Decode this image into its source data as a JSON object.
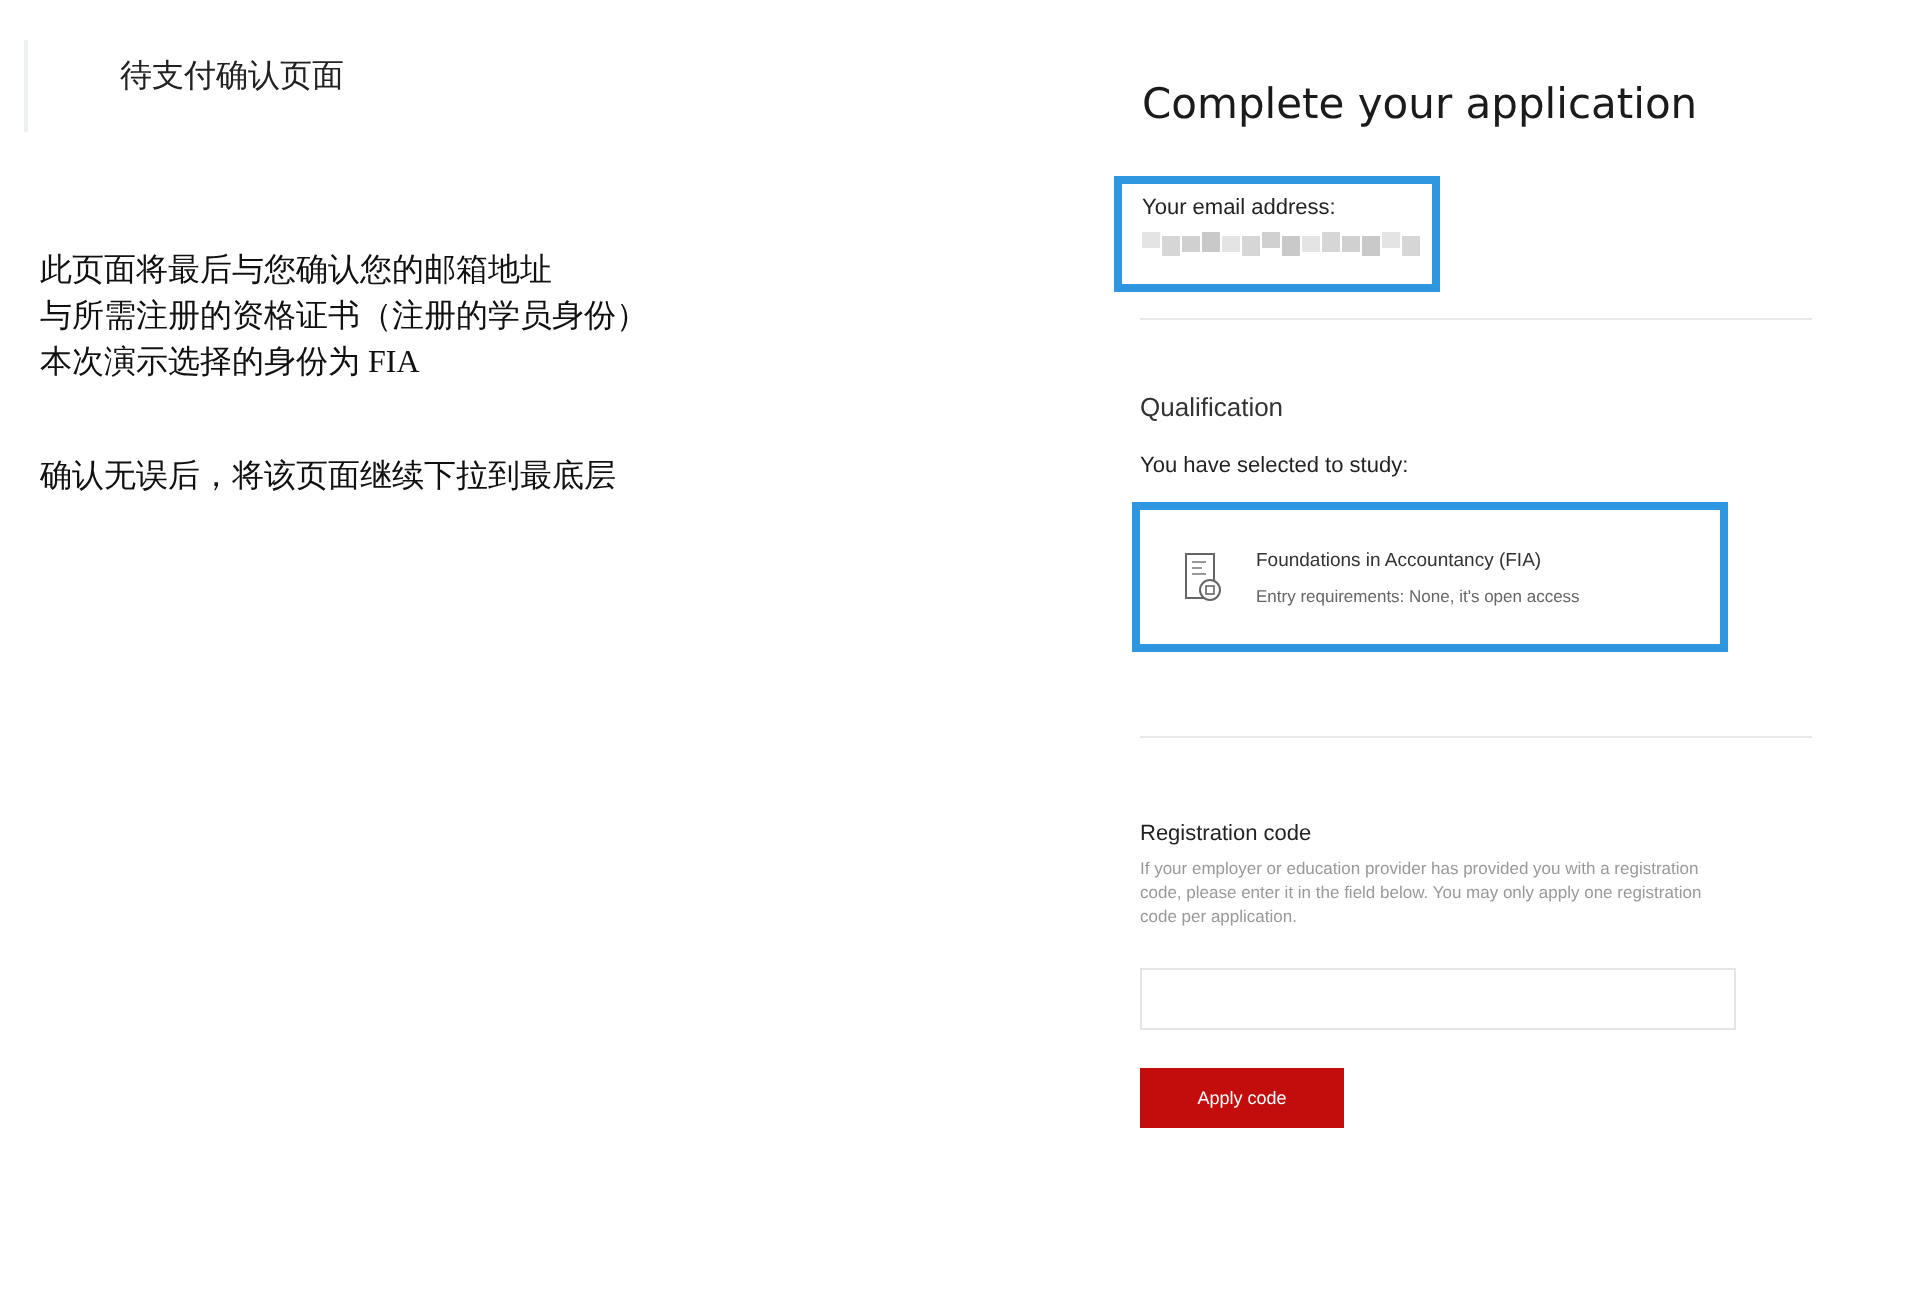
{
  "note": {
    "title": "待支付确认页面",
    "paragraphs": [
      [
        "此页面将最后与您确认您的邮箱地址",
        "与所需注册的资格证书（注册的学员身份）",
        "本次演示选择的身份为 FIA"
      ],
      [
        "确认无误后，将该页面继续下拉到最底层"
      ]
    ]
  },
  "page": {
    "title": "Complete your application",
    "email": {
      "label": "Your email address:",
      "highlighted": true
    },
    "qualification": {
      "heading": "Qualification",
      "intro": "You have selected to study:",
      "highlighted": true,
      "name": "Foundations in Accountancy (FIA)",
      "requirements_label": "Entry requirements:",
      "requirements": "None, it's open access"
    },
    "registration": {
      "heading": "Registration code",
      "description": "If your employer or education provider has provided you with a registration code, please enter it in the field below. You may only apply one registration code per application.",
      "button": "Apply code"
    }
  }
}
